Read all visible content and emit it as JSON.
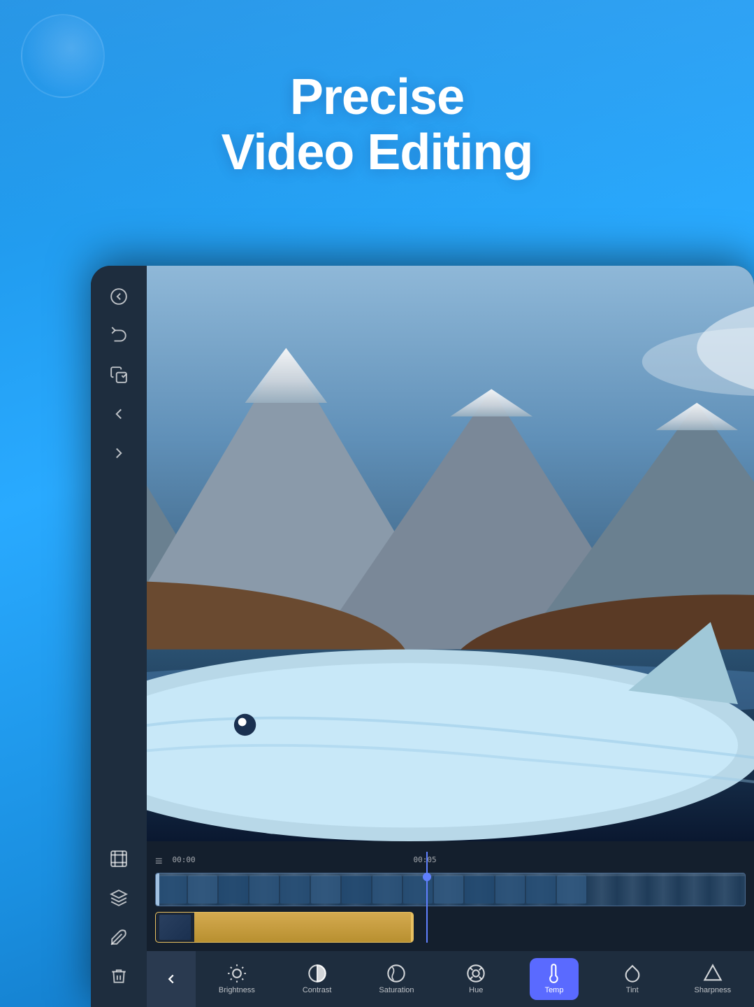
{
  "hero": {
    "title_line1": "Precise",
    "title_line2": "Video Editing"
  },
  "sidebar": {
    "icons": [
      {
        "name": "back-circle-icon",
        "label": "Back"
      },
      {
        "name": "undo-icon",
        "label": "Undo"
      },
      {
        "name": "copy-check-icon",
        "label": "Copy"
      },
      {
        "name": "undo-left-icon",
        "label": "Undo Left"
      },
      {
        "name": "redo-right-icon",
        "label": "Redo Right"
      },
      {
        "name": "grid-icon",
        "label": "Grid"
      },
      {
        "name": "filter-icon",
        "label": "Filter"
      },
      {
        "name": "paint-icon",
        "label": "Paint"
      },
      {
        "name": "delete-icon",
        "label": "Delete"
      }
    ]
  },
  "timeline": {
    "time_start": "00:00",
    "time_end": "00:05"
  },
  "toolbar": {
    "back_label": "<",
    "tools": [
      {
        "id": "brightness",
        "label": "Brightness",
        "active": false
      },
      {
        "id": "contrast",
        "label": "Contrast",
        "active": false
      },
      {
        "id": "saturation",
        "label": "Saturation",
        "active": false
      },
      {
        "id": "hue",
        "label": "Hue",
        "active": false
      },
      {
        "id": "temp",
        "label": "Temp",
        "active": true
      },
      {
        "id": "tint",
        "label": "Tint",
        "active": false
      },
      {
        "id": "sharpness",
        "label": "Sharpness",
        "active": false
      }
    ]
  }
}
